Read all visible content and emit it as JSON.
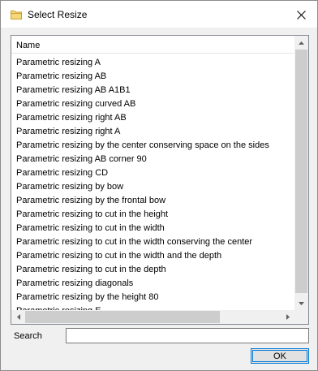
{
  "window": {
    "title": "Select Resize",
    "close_glyph": "✕"
  },
  "list": {
    "header": "Name",
    "items": [
      "Parametric resizing A",
      "Parametric resizing AB",
      "Parametric resizing AB A1B1",
      "Parametric resizing curved AB",
      "Parametric resizing right AB",
      "Parametric resizing right A",
      "Parametric resizing by the center conserving space on the sides",
      "Parametric resizing AB corner 90",
      "Parametric resizing CD",
      "Parametric resizing by bow",
      "Parametric resizing by the frontal bow",
      "Parametric resizing to cut in the height",
      "Parametric resizing to cut in the width",
      "Parametric resizing to cut in the width conserving the center",
      "Parametric resizing to cut in the width and the depth",
      "Parametric resizing to cut in the depth",
      "Parametric resizing diagonals",
      "Parametric resizing by the height 80",
      "Parametric resizing E"
    ]
  },
  "search": {
    "label": "Search",
    "value": ""
  },
  "ok_button": {
    "label": "OK"
  },
  "icons": {
    "title": "folder-icon",
    "close": "close-icon"
  },
  "colors": {
    "accent": "#0078d7",
    "folder": "#e8c15b"
  }
}
